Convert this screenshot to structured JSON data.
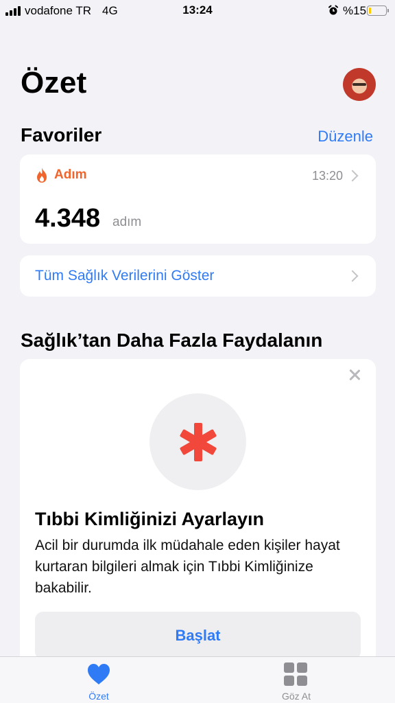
{
  "status_bar": {
    "carrier": "vodafone TR",
    "network": "4G",
    "time": "13:24",
    "battery_percent": "%15",
    "battery_level": 0.15
  },
  "header": {
    "title": "Özet"
  },
  "favorites": {
    "title": "Favoriler",
    "edit_label": "Düzenle",
    "steps": {
      "label": "Adım",
      "time": "13:20",
      "value": "4.348",
      "unit": "adım"
    },
    "show_all_label": "Tüm Sağlık Verilerini Göster"
  },
  "more": {
    "title": "Sağlık’tan Daha Fazla Faydalanın",
    "medical_id": {
      "title": "Tıbbi Kimliğinizi Ayarlayın",
      "description": "Acil bir durumda ilk müdahale eden kişiler hayat kurtaran bilgileri almak için Tıbbi Kimliğinize bakabilir.",
      "button_label": "Başlat"
    }
  },
  "tab_bar": {
    "tabs": [
      {
        "label": "Özet",
        "icon": "heart-icon",
        "active": true
      },
      {
        "label": "Göz At",
        "icon": "grid-icon",
        "active": false
      }
    ]
  },
  "colors": {
    "accent": "#2f7bf5",
    "steps_orange": "#f0652d",
    "medical_red": "#f2473b",
    "background": "#f2f2f7"
  }
}
